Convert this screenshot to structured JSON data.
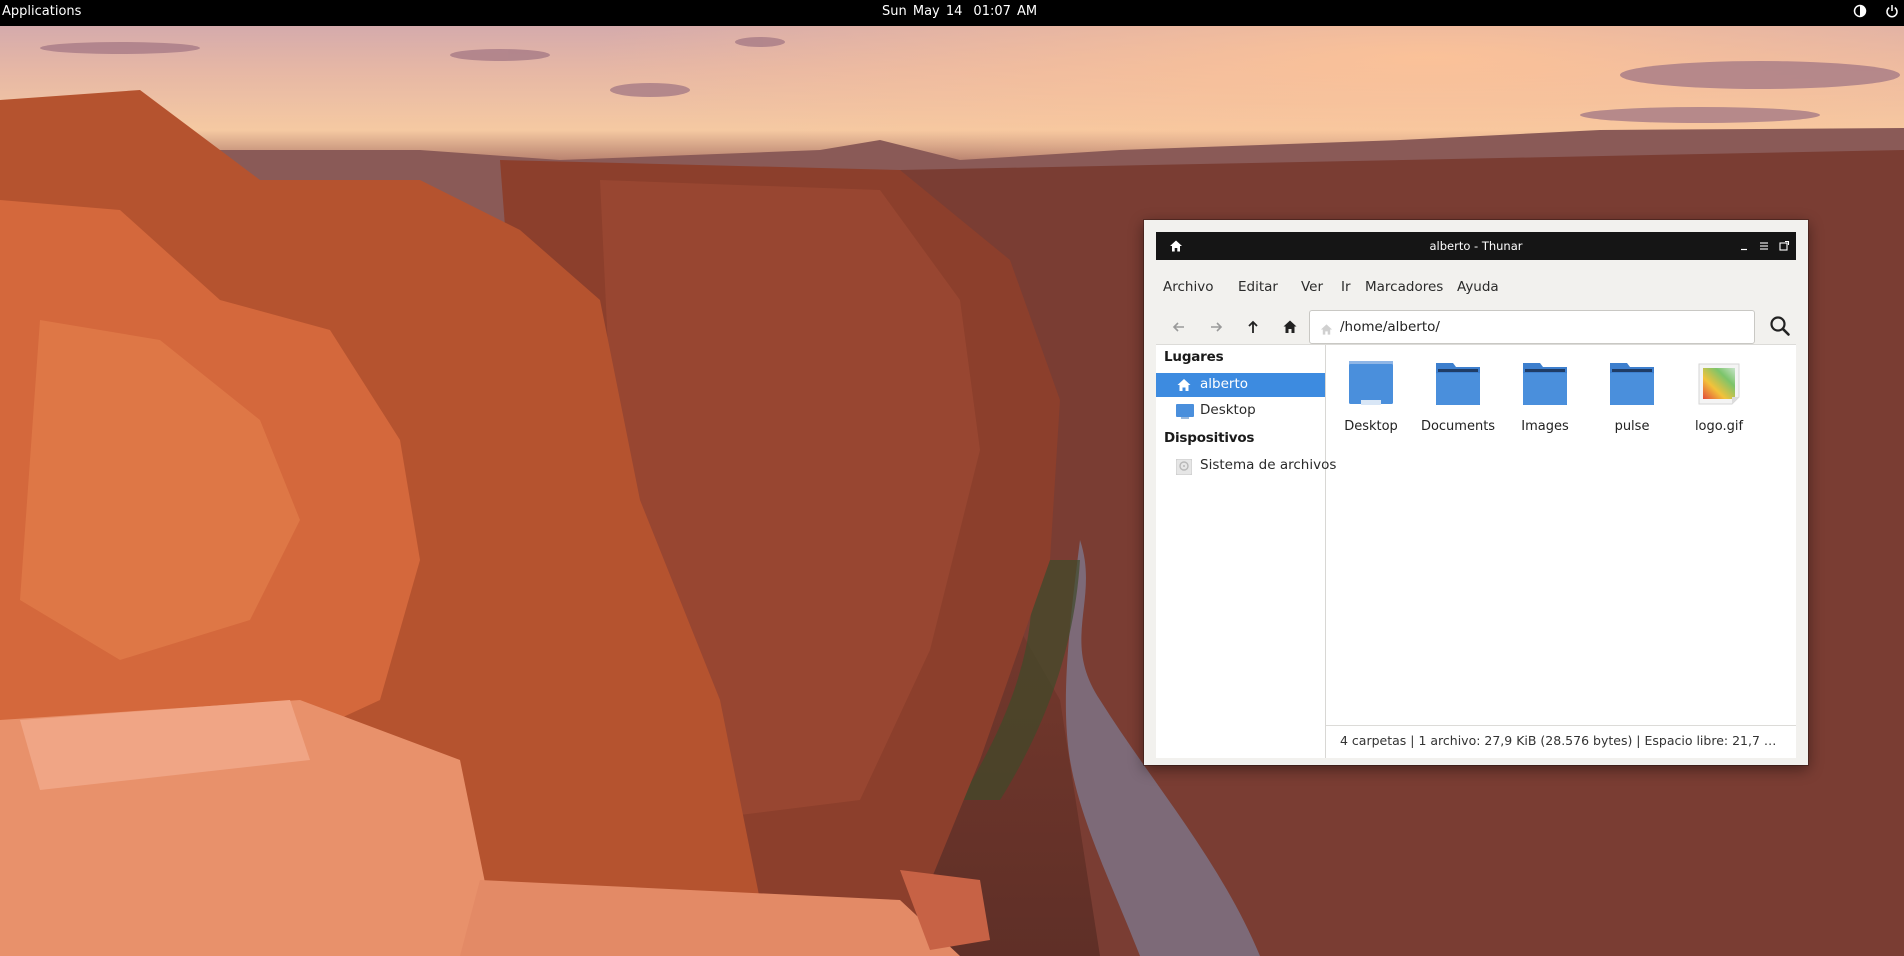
{
  "top_panel": {
    "applications_label": "Applications",
    "date": "Sun May 14",
    "time": "01:07 AM",
    "tray": [
      "contrast-icon",
      "power-icon"
    ]
  },
  "window": {
    "title": "alberto - Thunar",
    "titlebar_icons": [
      "home-icon",
      "minimize-icon",
      "menu-icon",
      "maximize-icon"
    ]
  },
  "menubar": {
    "items": [
      "Archivo",
      "Editar",
      "Ver",
      "Ir",
      "Marcadores",
      "Ayuda"
    ]
  },
  "toolbar": {
    "path_value": "/home/alberto/",
    "buttons": [
      "back-arrow-icon",
      "forward-arrow-icon",
      "up-arrow-icon",
      "home-icon",
      "search-icon"
    ]
  },
  "sidebar": {
    "places_heading": "Lugares",
    "places": [
      {
        "label": "alberto",
        "icon": "home-icon",
        "selected": true
      },
      {
        "label": "Desktop",
        "icon": "desktop-icon",
        "selected": false
      }
    ],
    "devices_heading": "Dispositivos",
    "devices": [
      {
        "label": "Sistema de archivos",
        "icon": "drive-icon",
        "selected": false
      }
    ]
  },
  "files": [
    {
      "name": "Desktop",
      "icon": "desktop-folder-icon"
    },
    {
      "name": "Documents",
      "icon": "folder-icon"
    },
    {
      "name": "Images",
      "icon": "folder-icon"
    },
    {
      "name": "pulse",
      "icon": "folder-icon"
    },
    {
      "name": "logo.gif",
      "icon": "image-file-icon"
    }
  ],
  "statusbar": {
    "text": "4 carpetas  |  1 archivo: 27,9 KiB (28.576 bytes)  |  Espacio libre: 21,7 G..."
  },
  "colors": {
    "selection": "#3d8be0",
    "folder": "#4a8fdc",
    "titlebar": "#151515"
  }
}
